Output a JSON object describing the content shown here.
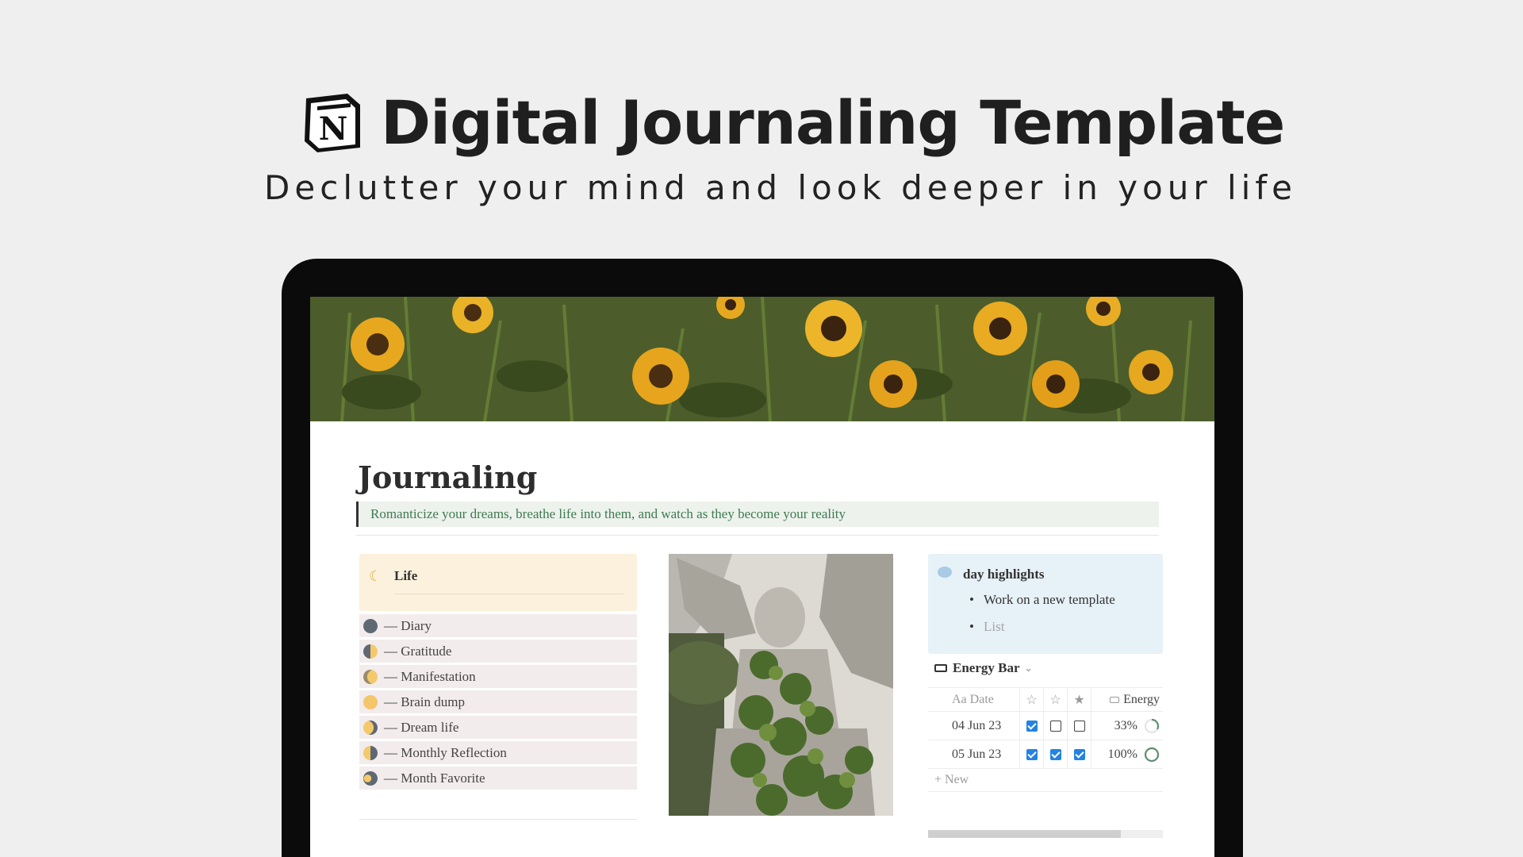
{
  "hero": {
    "title": "Digital Journaling Template",
    "subtitle": "Declutter your mind and look deeper in your life"
  },
  "page": {
    "title": "Journaling",
    "quote": "Romanticize your dreams, breathe life into them, and watch as they become your reality"
  },
  "life": {
    "title": "Life",
    "items": [
      {
        "label": "— Diary",
        "phase": "new-moon",
        "color": "#5f6973"
      },
      {
        "label": "— Gratitude",
        "phase": "first-quarter",
        "color": "#f3c96b"
      },
      {
        "label": "— Manifestation",
        "phase": "waxing-gibbous",
        "color": "#f3c96b"
      },
      {
        "label": "— Brain dump",
        "phase": "full-moon",
        "color": "#f5c56a"
      },
      {
        "label": "— Dream life",
        "phase": "waning-gibbous",
        "color": "#f3c96b"
      },
      {
        "label": "— Monthly Reflection",
        "phase": "last-quarter",
        "color": "#f3c96b"
      },
      {
        "label": "— Month Favorite",
        "phase": "waning-crescent",
        "color": "#5f6973"
      }
    ]
  },
  "highlights": {
    "title": "day highlights",
    "items": [
      "Work on a new template"
    ],
    "placeholder": "List"
  },
  "energy_db": {
    "title": "Energy Bar",
    "columns": {
      "date": "Aa Date",
      "energy": "Energy"
    },
    "rows": [
      {
        "date": "04 Jun 23",
        "checks": [
          true,
          false,
          false
        ],
        "energy": "33%",
        "fraction": 0.33
      },
      {
        "date": "05 Jun 23",
        "checks": [
          true,
          true,
          true
        ],
        "energy": "100%",
        "fraction": 1.0
      }
    ],
    "new_label": "+ New",
    "scroll_fraction": 0.82
  }
}
